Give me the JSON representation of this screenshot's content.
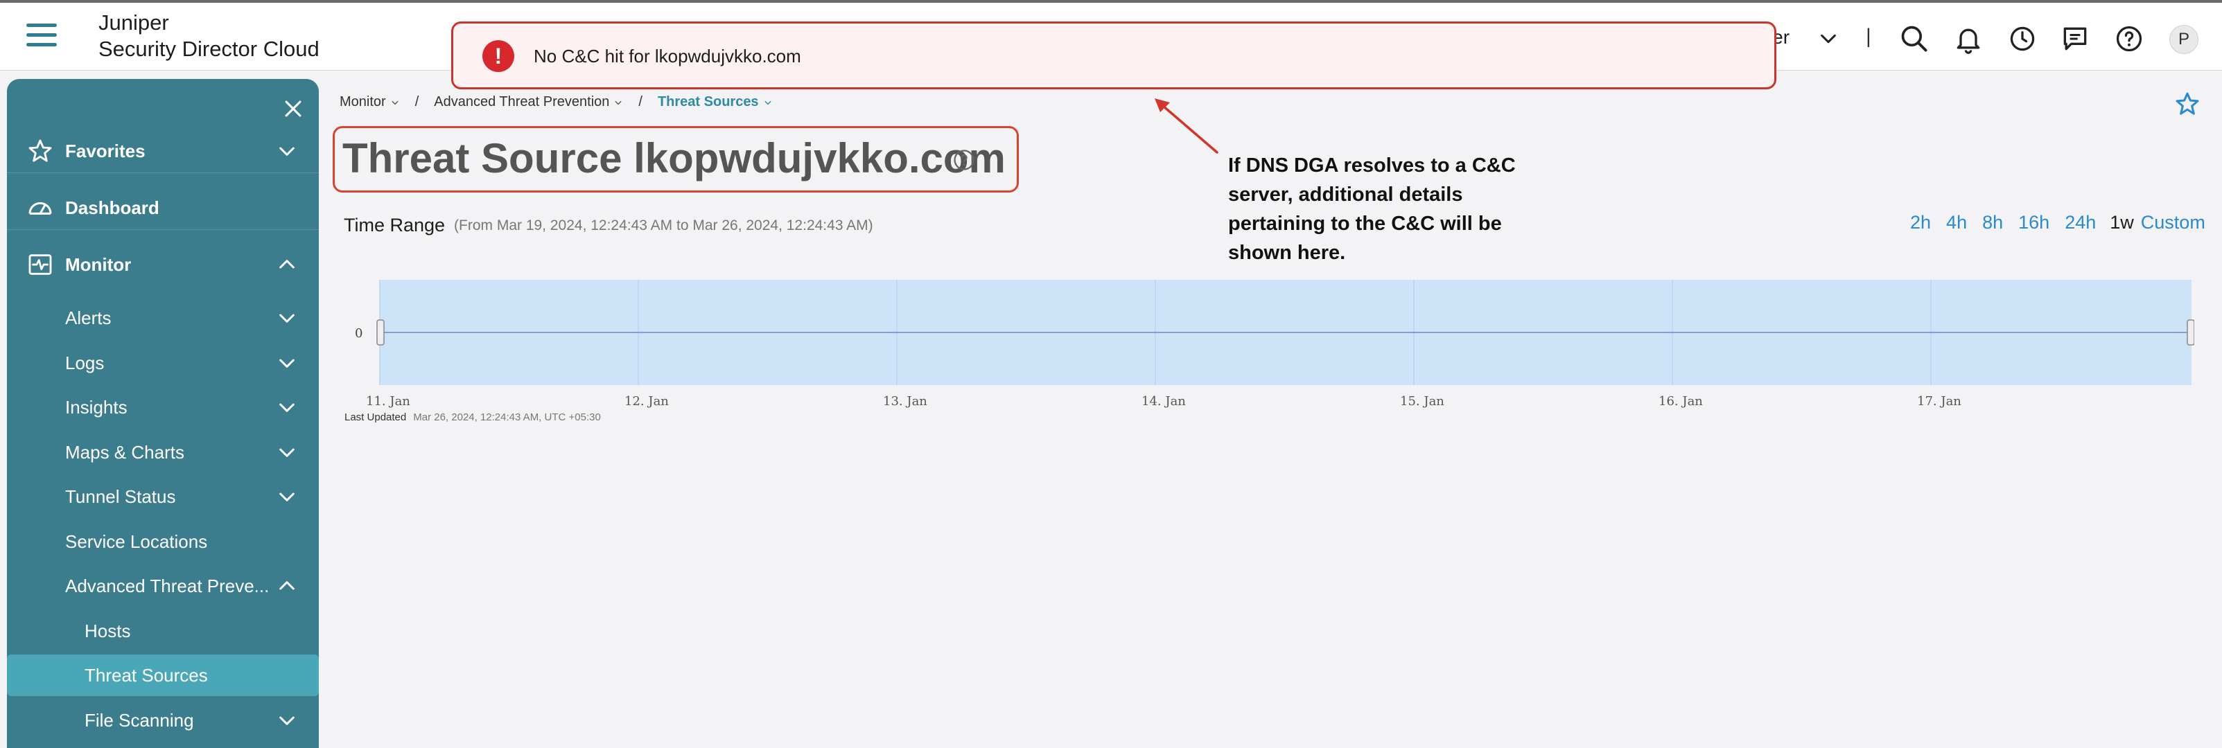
{
  "header": {
    "brand_line1": "Juniper",
    "brand_line2": "Security Director Cloud",
    "org_label": "uper",
    "separator": "|"
  },
  "toast": {
    "icon": "!",
    "message": "No C&C hit for lkopwdujvkko.com"
  },
  "annotation": {
    "text": "If DNS DGA resolves to a C&C server, additional details pertaining to the C&C will be shown here."
  },
  "sidebar": {
    "items": [
      {
        "label": "Favorites"
      },
      {
        "label": "Dashboard"
      },
      {
        "label": "Monitor"
      },
      {
        "label": "Alerts"
      },
      {
        "label": "Logs"
      },
      {
        "label": "Insights"
      },
      {
        "label": "Maps & Charts"
      },
      {
        "label": "Tunnel Status"
      },
      {
        "label": "Service Locations"
      },
      {
        "label": "Advanced Threat Preve..."
      },
      {
        "label": "Hosts"
      },
      {
        "label": "Threat Sources"
      },
      {
        "label": "File Scanning"
      }
    ]
  },
  "breadcrumb": {
    "items": [
      "Monitor",
      "Advanced Threat Prevention",
      "Threat Sources"
    ],
    "separator": "/"
  },
  "page": {
    "title": "Threat Source lkopwdujvkko.com"
  },
  "time_range": {
    "label": "Time Range",
    "range_text": "(From Mar 19, 2024, 12:24:43 AM to Mar 26, 2024, 12:24:43 AM)",
    "options": [
      "2h",
      "4h",
      "8h",
      "16h",
      "24h",
      "1w",
      "Custom"
    ],
    "selected": "1w"
  },
  "last_updated": {
    "label": "Last Updated",
    "value": "Mar 26, 2024, 12:24:43 AM, UTC +05:30"
  },
  "colors": {
    "sidebar_bg": "#3b7d8d",
    "sidebar_active": "#4aa7b8",
    "accent_blue": "#2a8ad0",
    "toast_border": "#c9352c",
    "chart_fill": "#cde3f7",
    "chart_line": "#8b94e6"
  },
  "chart_data": {
    "type": "line",
    "x": [
      "11. Jan",
      "12. Jan",
      "13. Jan",
      "14. Jan",
      "15. Jan",
      "16. Jan",
      "17. Jan"
    ],
    "series": [
      {
        "values": [
          0,
          0,
          0,
          0,
          0,
          0,
          0
        ]
      }
    ],
    "yticks": [
      "0"
    ],
    "grid": true
  }
}
